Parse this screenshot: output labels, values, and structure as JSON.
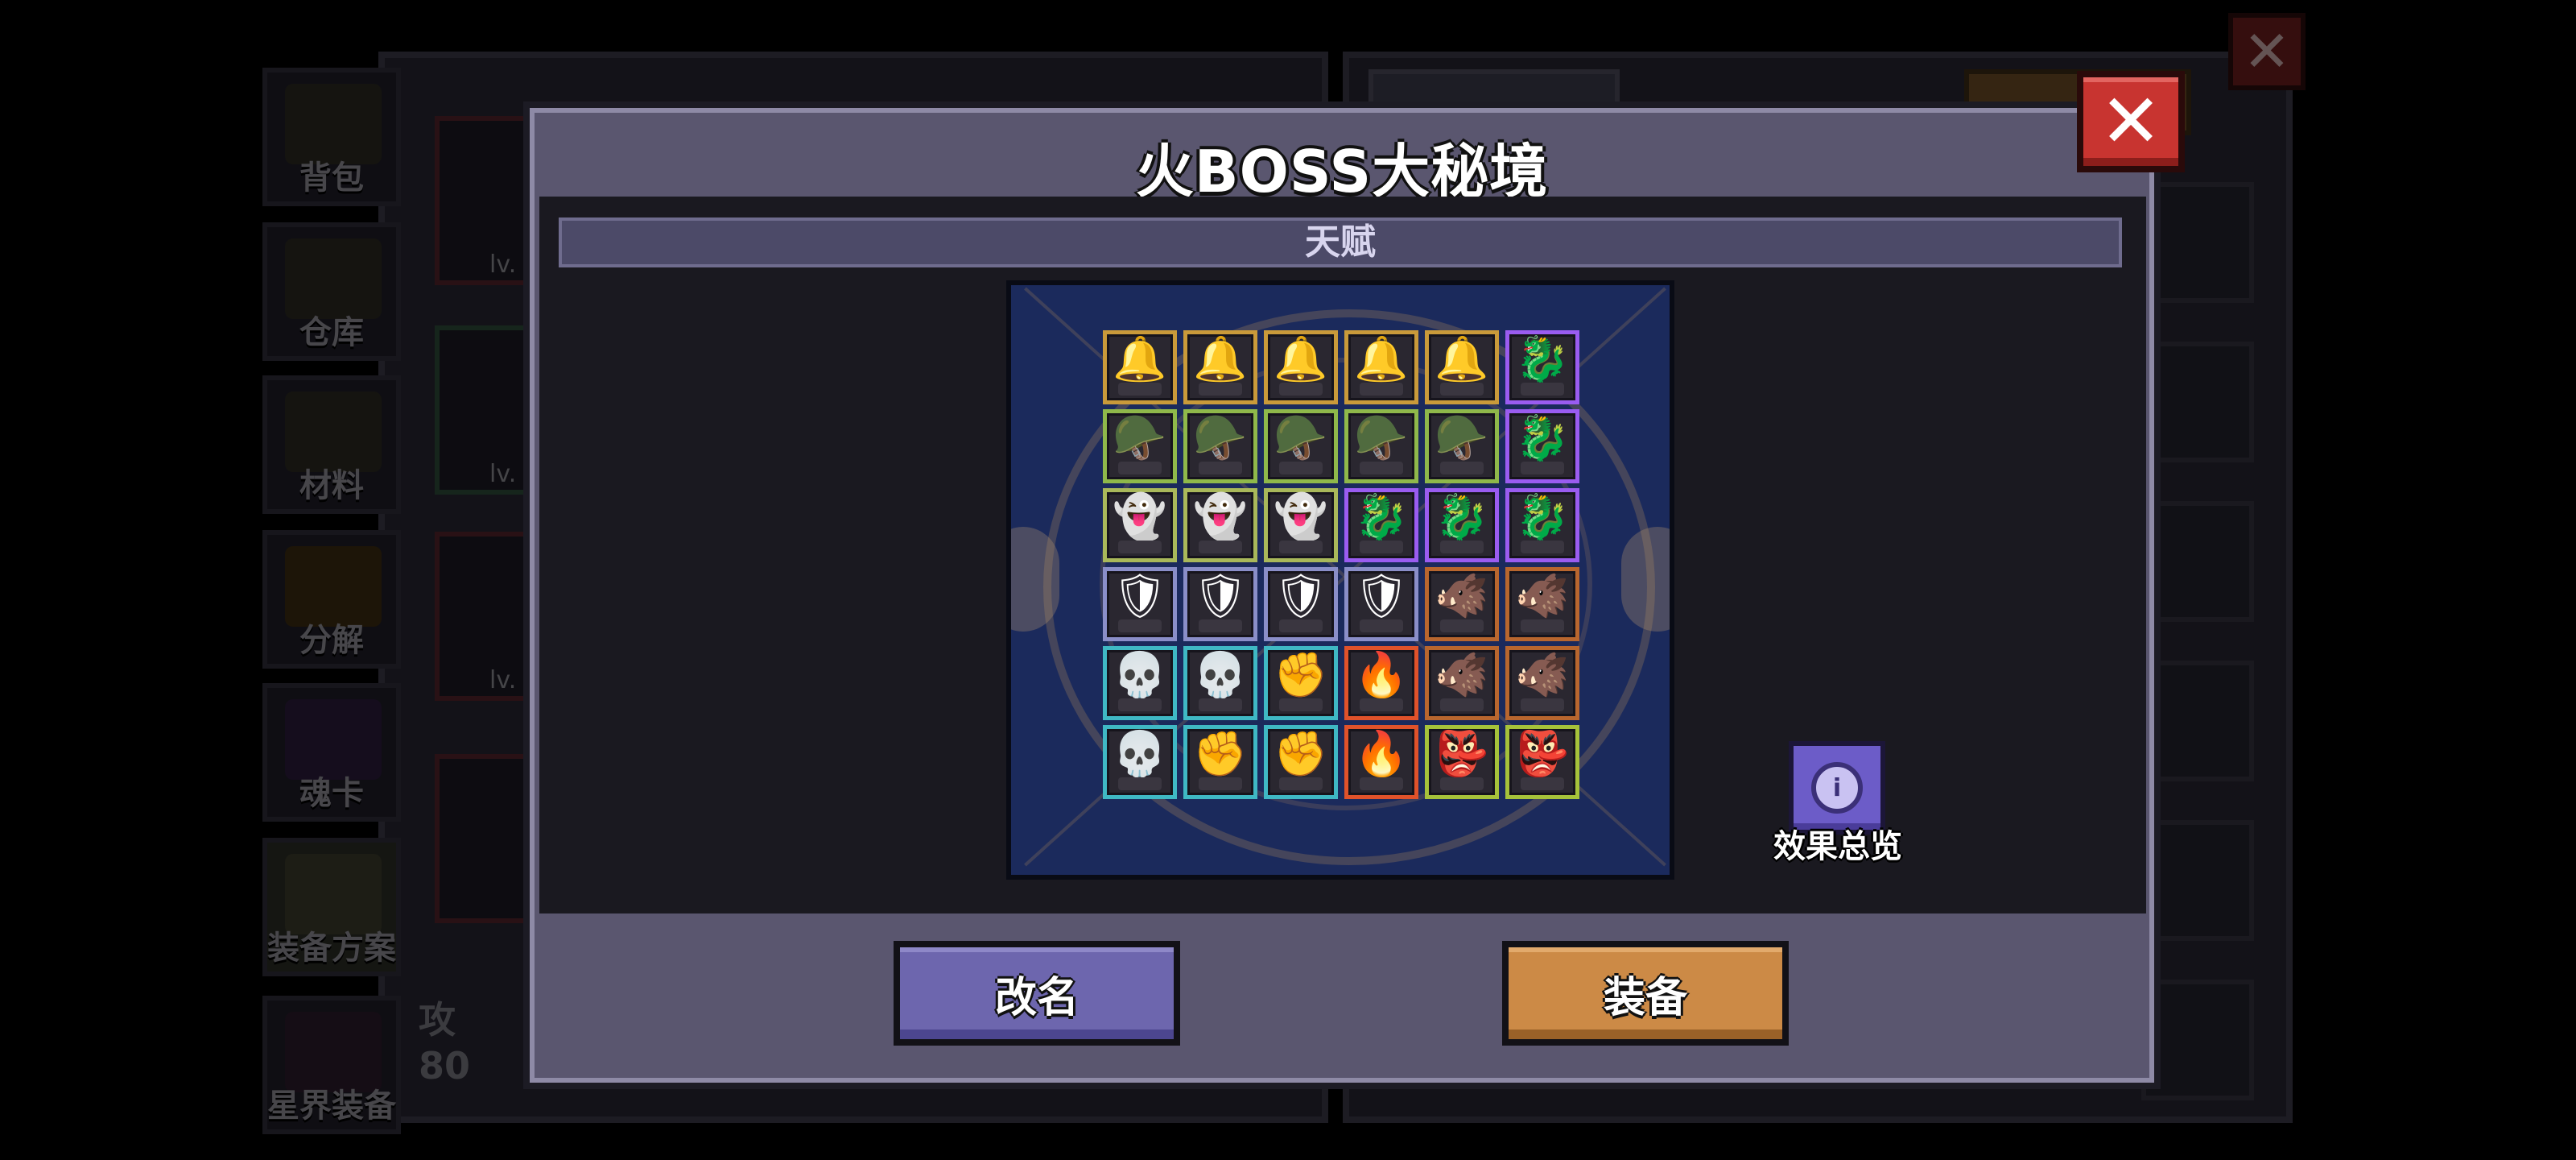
{
  "background": {
    "side_tabs": [
      "背包",
      "仓库",
      "材料",
      "分解",
      "魂卡",
      "装备方案",
      "星界装备"
    ],
    "card_level_prefix": "lv.",
    "attack_label": "攻",
    "attack_value": "80"
  },
  "modal": {
    "title": "火BOSS大秘境",
    "section_title": "天赋",
    "effect_overview_label": "效果总览",
    "rename_button": "改名",
    "equip_button": "装备"
  },
  "talent_grid": {
    "rows": [
      [
        "gold-lamp",
        "gold-lamp",
        "gold-lamp",
        "gold-lamp",
        "gold-lamp",
        "purple-dragon"
      ],
      [
        "green-helm",
        "green-helm",
        "green-helm",
        "green-helm",
        "green-helm",
        "purple-dragon"
      ],
      [
        "pale-ghost",
        "pale-ghost",
        "pale-ghost",
        "purple-dragon",
        "purple-dragon",
        "purple-dragon"
      ],
      [
        "silver-knight",
        "silver-knight",
        "silver-knight",
        "silver-knight",
        "brown-beast",
        "brown-beast"
      ],
      [
        "white-skull",
        "white-skull",
        "white-fist",
        "fire-demon",
        "brown-beast",
        "brown-beast"
      ],
      [
        "white-skull",
        "white-fist",
        "white-fist",
        "fire-demon",
        "green-goblin",
        "green-goblin"
      ]
    ],
    "frame_colors": {
      "gold-lamp": "#c99a3a",
      "green-helm": "#8fb84a",
      "pale-ghost": "#a9b85a",
      "purple-dragon": "#9a5cf0",
      "silver-knight": "#8a8ec8",
      "brown-beast": "#b8662e",
      "white-skull": "#3fb8c4",
      "white-fist": "#3fb8c4",
      "fire-demon": "#e0522a",
      "green-goblin": "#a6c23a"
    },
    "glyphs": {
      "gold-lamp": "🔔",
      "green-helm": "🪖",
      "pale-ghost": "👻",
      "purple-dragon": "🐉",
      "silver-knight": "🛡",
      "brown-beast": "🐗",
      "white-skull": "💀",
      "white-fist": "✊",
      "fire-demon": "🔥",
      "green-goblin": "👺"
    }
  },
  "colors": {
    "modal_bg": "#5a566f",
    "close_red": "#c83430",
    "rename_purple": "#6d66ae",
    "equip_orange": "#cc8a46",
    "board_blue": "#1b2a5c"
  }
}
